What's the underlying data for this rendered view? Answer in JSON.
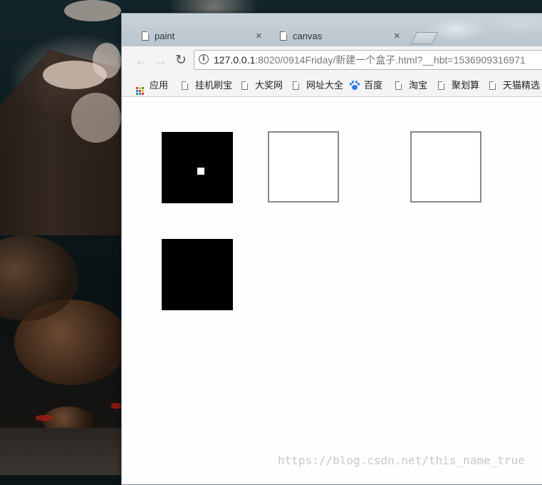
{
  "tabs": [
    {
      "title": "paint",
      "active": false
    },
    {
      "title": "canvas",
      "active": true
    }
  ],
  "tab_close_glyph": "×",
  "nav": {
    "back_icon": "arrow-left-icon",
    "forward_icon": "arrow-right-icon",
    "reload_icon": "reload-icon",
    "info_glyph": "i"
  },
  "address": {
    "host": "127.0.0.1",
    "path": ":8020/0914Friday/新建一个盒子.html?__hbt=1536909316971"
  },
  "bookmarks": [
    {
      "label": "应用",
      "icon": "apps-grid-icon"
    },
    {
      "label": "挂机刷宝",
      "icon": "page-icon"
    },
    {
      "label": "大奖网",
      "icon": "page-icon"
    },
    {
      "label": "网址大全",
      "icon": "page-icon"
    },
    {
      "label": "百度",
      "icon": "baidu-paw-icon"
    },
    {
      "label": "淘宝",
      "icon": "page-icon"
    },
    {
      "label": "聚划算",
      "icon": "page-icon"
    },
    {
      "label": "天猫精选",
      "icon": "page-icon"
    }
  ],
  "canvas_boxes": [
    {
      "style": "filled",
      "has_dot": true
    },
    {
      "style": "outline",
      "has_dot": false
    },
    {
      "style": "outline",
      "has_dot": false
    },
    {
      "style": "filled",
      "has_dot": false
    }
  ],
  "colors": {
    "box_fill": "#030100",
    "box_outline": "#888888",
    "dot": "#ffffff"
  },
  "watermark": "https://blog.csdn.net/this_name_true"
}
